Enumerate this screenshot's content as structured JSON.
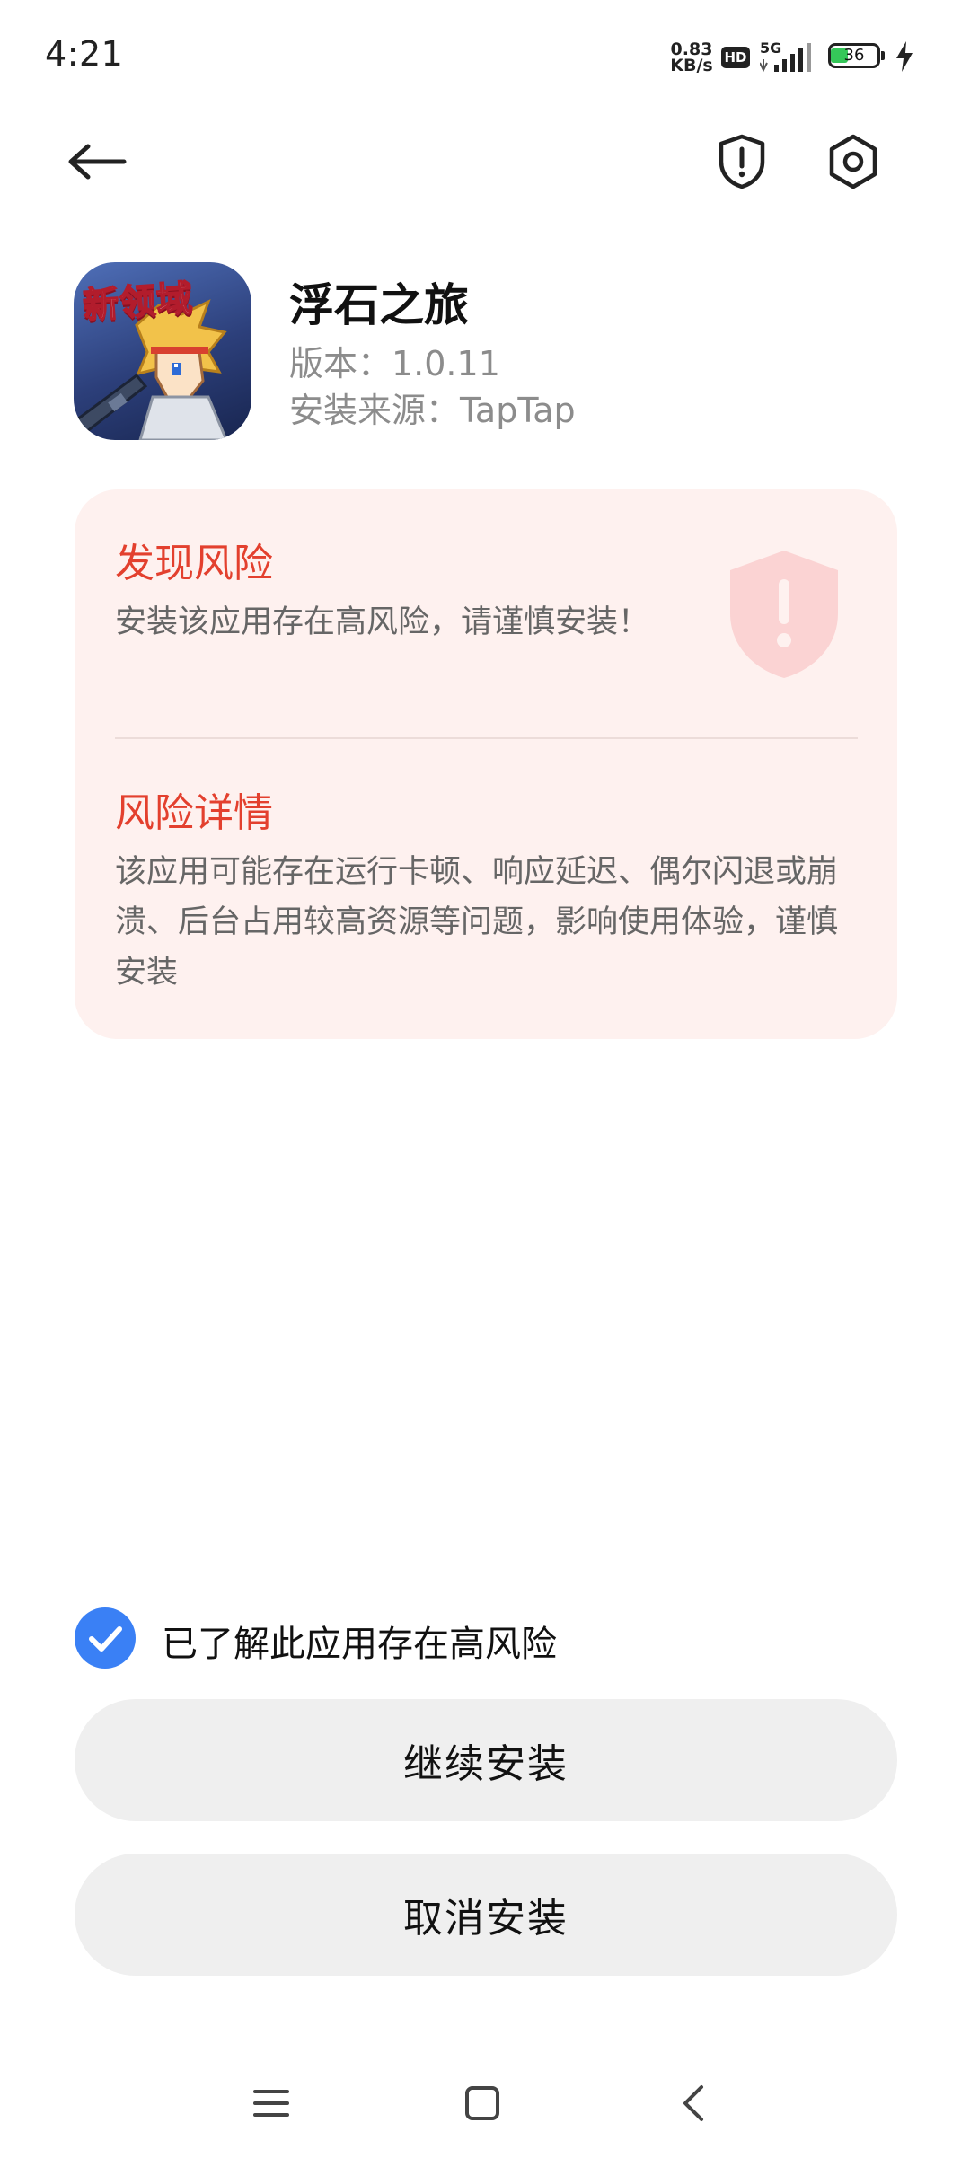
{
  "status_bar": {
    "time": "4:21",
    "net_speed_value": "0.83",
    "net_speed_unit": "KB/s",
    "hd_label": "HD",
    "network_label": "5G",
    "battery_level": "36",
    "battery_percent": 36
  },
  "nav": {
    "back_icon": "arrow-left-icon",
    "security_icon": "shield-exclamation-icon",
    "settings_icon": "gear-icon"
  },
  "app": {
    "name": "浮石之旅",
    "version_label": "版本：1.0.11",
    "source_label": "安装来源：TapTap",
    "icon_tag": "新领域"
  },
  "risk": {
    "title": "发现风险",
    "description": "安装该应用存在高风险，请谨慎安装！",
    "detail_title": "风险详情",
    "detail_description": "该应用可能存在运行卡顿、响应延迟、偶尔闪退或崩溃、后台占用较高资源等问题，影响使用体验，谨慎安装"
  },
  "actions": {
    "acknowledge_label": "已了解此应用存在高风险",
    "acknowledge_checked": true,
    "continue_label": "继续安装",
    "cancel_label": "取消安装"
  },
  "system_nav": {
    "menu_icon": "menu-icon",
    "home_icon": "home-square-icon",
    "back_icon": "chevron-left-icon"
  },
  "colors": {
    "accent_blue": "#3a80f5",
    "risk_red": "#e3402e",
    "risk_card_bg": "#fef1ef",
    "button_bg": "#efefef"
  }
}
